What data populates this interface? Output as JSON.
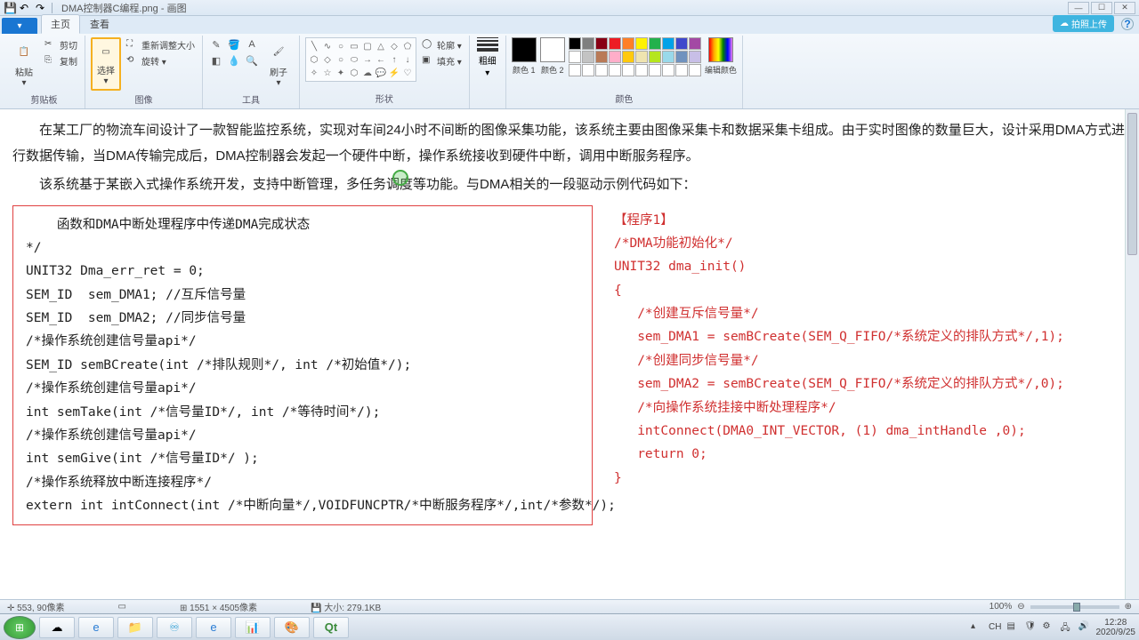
{
  "window": {
    "filename": "DMA控制器C编程.png",
    "app": "画图"
  },
  "tabs": {
    "app": "▾",
    "home": "主页",
    "view": "查看"
  },
  "ribbon": {
    "clipboard": {
      "paste": "粘贴",
      "cut": "剪切",
      "copy": "复制",
      "label": "剪贴板"
    },
    "image": {
      "select": "选择",
      "resize": "重新调整大小",
      "rotate": "旋转 ▾",
      "label": "图像"
    },
    "tools": {
      "brush": "刷子",
      "label": "工具"
    },
    "shapes": {
      "outline": "轮廓 ▾",
      "fill": "填充 ▾",
      "label": "形状"
    },
    "stroke": {
      "label": "粗细"
    },
    "colors": {
      "c1": "颜色 1",
      "c2": "颜色 2",
      "edit": "编辑颜色",
      "label": "颜色"
    }
  },
  "cloud_btn": "拍照上传",
  "doc": {
    "p1": "在某工厂的物流车间设计了一款智能监控系统，实现对车间24小时不间断的图像采集功能，该系统主要由图像采集卡和数据采集卡组成。由于实时图像的数量巨大，设计采用DMA方式进行数据传输，当DMA传输完成后，DMA控制器会发起一个硬件中断，操作系统接收到硬件中断，调用中断服务程序。",
    "p2": "该系统基于某嵌入式操作系统开发，支持中断管理，多任务调度等功能。与DMA相关的一段驱动示例代码如下：",
    "left": [
      "    函数和DMA中断处理程序中传递DMA完成状态",
      "*/",
      "UNIT32 Dma_err_ret = 0;",
      "SEM_ID  sem_DMA1; //互斥信号量",
      "SEM_ID  sem_DMA2; //同步信号量",
      "",
      "/*操作系统创建信号量api*/",
      "SEM_ID semBCreate(int /*排队规则*/, int /*初始值*/);",
      "/*操作系统创建信号量api*/",
      "int semTake(int /*信号量ID*/, int /*等待时间*/);",
      "/*操作系统创建信号量api*/",
      "int semGive(int /*信号量ID*/ );",
      "/*操作系统释放中断连接程序*/",
      "extern int intConnect(int /*中断向量*/,VOIDFUNCPTR/*中断服务程序*/,int/*参数*/);"
    ],
    "right": [
      "【程序1】",
      "/*DMA功能初始化*/",
      "UNIT32 dma_init()",
      "{",
      "   /*创建互斥信号量*/",
      "   sem_DMA1 = semBCreate(SEM_Q_FIFO/*系统定义的排队方式*/,1);",
      "   /*创建同步信号量*/",
      "   sem_DMA2 = semBCreate(SEM_Q_FIFO/*系统定义的排队方式*/,0);",
      "   /*向操作系统挂接中断处理程序*/",
      "   intConnect(DMA0_INT_VECTOR, (1) dma_intHandle ,0);",
      "   return 0;",
      "}"
    ]
  },
  "status": {
    "pos_label": "553, 90像素",
    "canvas_size": "1551 × 4505像素",
    "file_size": "大小: 279.1KB",
    "zoom": "100%"
  },
  "clock": {
    "time": "12:28",
    "date": "2020/9/25"
  },
  "palette_colors": [
    "#000",
    "#7f7f7f",
    "#880015",
    "#ed1c24",
    "#ff7f27",
    "#fff200",
    "#22b14c",
    "#00a2e8",
    "#3f48cc",
    "#a349a4",
    "#fff",
    "#c3c3c3",
    "#b97a57",
    "#ffaec9",
    "#ffc90e",
    "#efe4b0",
    "#b5e61d",
    "#99d9ea",
    "#7092be",
    "#c8bfe7",
    "#fff",
    "#fff",
    "#fff",
    "#fff",
    "#fff",
    "#fff",
    "#fff",
    "#fff",
    "#fff",
    "#fff"
  ]
}
